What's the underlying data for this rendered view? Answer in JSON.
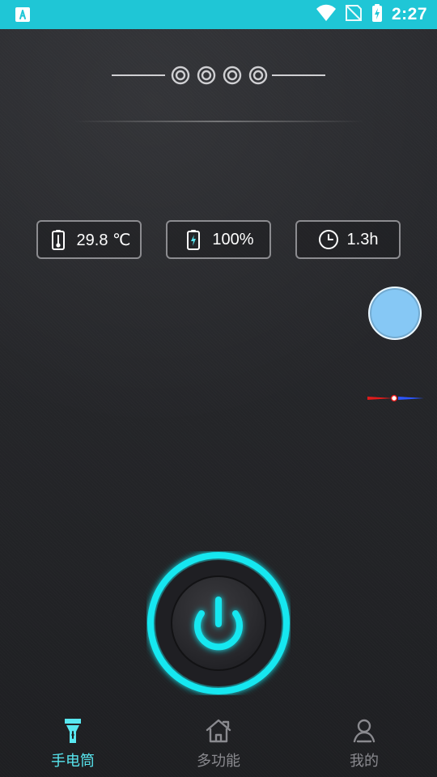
{
  "status_bar": {
    "time": "2:27",
    "icons": [
      "app-a-icon",
      "wifi-icon",
      "no-sim-icon",
      "battery-charging-icon"
    ],
    "bg_color": "#1fc6d6"
  },
  "stats": [
    {
      "value": "29.8 ℃",
      "icon": "thermometer-battery-icon"
    },
    {
      "value": "100%",
      "icon": "battery-charging-icon"
    },
    {
      "value": "1.3h",
      "icon": "clock-icon"
    }
  ],
  "power_button": {
    "glow_color": "#13e7f0",
    "state": "on"
  },
  "bottom_nav": {
    "items": [
      {
        "label": "手电筒",
        "icon": "flashlight-icon",
        "active": true
      },
      {
        "label": "多功能",
        "icon": "home-icon",
        "active": false
      },
      {
        "label": "我的",
        "icon": "profile-icon",
        "active": false
      }
    ],
    "active_color": "#58e7f0",
    "inactive_color": "#8a8a8f"
  },
  "floating_widget": {
    "color": "#86c8f5"
  },
  "compass": {
    "north_color": "#e01b1b",
    "south_color": "#2c56ff"
  }
}
